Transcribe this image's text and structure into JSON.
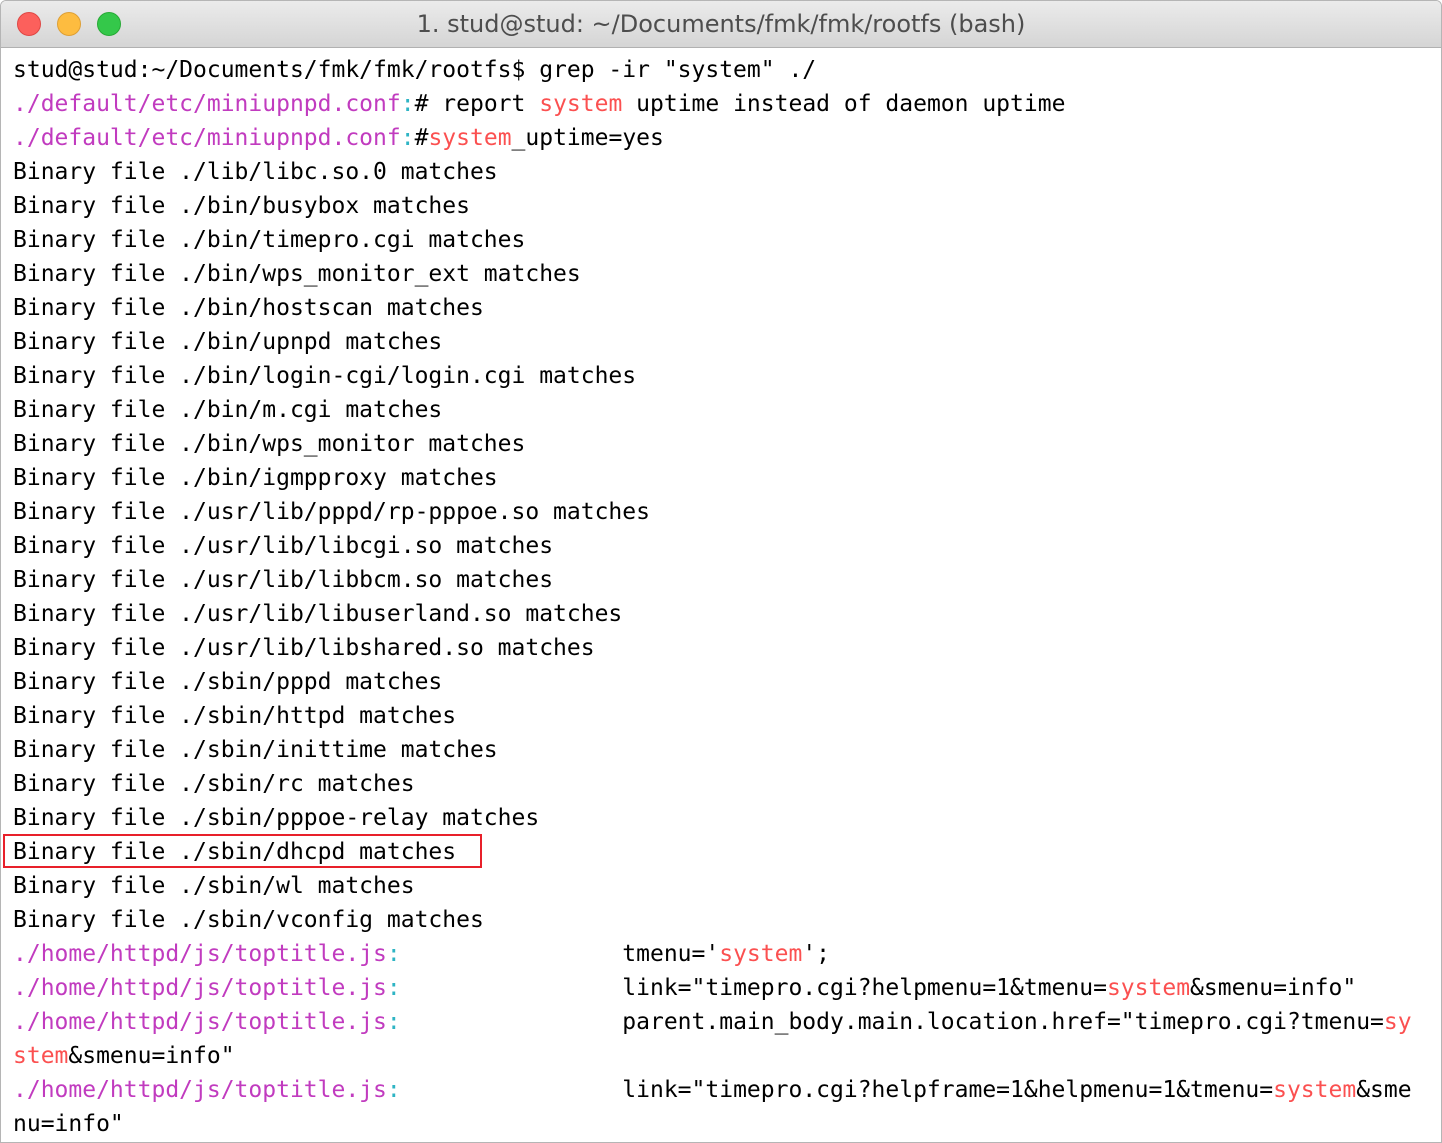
{
  "window": {
    "title": "1. stud@stud: ~/Documents/fmk/fmk/rootfs (bash)"
  },
  "terminal": {
    "command_line": "stud@stud:~/Documents/fmk/fmk/rootfs$ grep -ir \"system\" ./",
    "lines": [
      [
        {
          "t": "./default/etc/miniupnpd.conf",
          "c": "path"
        },
        {
          "t": ":",
          "c": "sep"
        },
        {
          "t": "# report "
        },
        {
          "t": "system",
          "c": "match"
        },
        {
          "t": " uptime instead of daemon uptime"
        }
      ],
      [
        {
          "t": "./default/etc/miniupnpd.conf",
          "c": "path"
        },
        {
          "t": ":",
          "c": "sep"
        },
        {
          "t": "#"
        },
        {
          "t": "system",
          "c": "match"
        },
        {
          "t": "_uptime=yes"
        }
      ],
      [
        {
          "t": "Binary file ./lib/libc.so.0 matches"
        }
      ],
      [
        {
          "t": "Binary file ./bin/busybox matches"
        }
      ],
      [
        {
          "t": "Binary file ./bin/timepro.cgi matches"
        }
      ],
      [
        {
          "t": "Binary file ./bin/wps_monitor_ext matches"
        }
      ],
      [
        {
          "t": "Binary file ./bin/hostscan matches"
        }
      ],
      [
        {
          "t": "Binary file ./bin/upnpd matches"
        }
      ],
      [
        {
          "t": "Binary file ./bin/login-cgi/login.cgi matches"
        }
      ],
      [
        {
          "t": "Binary file ./bin/m.cgi matches"
        }
      ],
      [
        {
          "t": "Binary file ./bin/wps_monitor matches"
        }
      ],
      [
        {
          "t": "Binary file ./bin/igmpproxy matches"
        }
      ],
      [
        {
          "t": "Binary file ./usr/lib/pppd/rp-pppoe.so matches"
        }
      ],
      [
        {
          "t": "Binary file ./usr/lib/libcgi.so matches"
        }
      ],
      [
        {
          "t": "Binary file ./usr/lib/libbcm.so matches"
        }
      ],
      [
        {
          "t": "Binary file ./usr/lib/libuserland.so matches"
        }
      ],
      [
        {
          "t": "Binary file ./usr/lib/libshared.so matches"
        }
      ],
      [
        {
          "t": "Binary file ./sbin/pppd matches"
        }
      ],
      [
        {
          "t": "Binary file ./sbin/httpd matches"
        }
      ],
      [
        {
          "t": "Binary file ./sbin/inittime matches"
        }
      ],
      [
        {
          "t": "Binary file ./sbin/rc matches"
        }
      ],
      [
        {
          "t": "Binary file ./sbin/pppoe-relay matches"
        }
      ],
      [
        {
          "t": "Binary file ./sbin/dhcpd matches"
        }
      ],
      [
        {
          "t": "Binary file ./sbin/wl matches"
        }
      ],
      [
        {
          "t": "Binary file ./sbin/vconfig matches"
        }
      ],
      [
        {
          "t": "./home/httpd/js/toptitle.js",
          "c": "path"
        },
        {
          "t": ":",
          "c": "sep"
        },
        {
          "t": "\t\t\ttmenu='"
        },
        {
          "t": "system",
          "c": "match"
        },
        {
          "t": "';"
        }
      ],
      [
        {
          "t": "./home/httpd/js/toptitle.js",
          "c": "path"
        },
        {
          "t": ":",
          "c": "sep"
        },
        {
          "t": "\t\t\tlink=\"timepro.cgi?helpmenu=1&tmenu="
        },
        {
          "t": "system",
          "c": "match"
        },
        {
          "t": "&smenu=info\""
        }
      ],
      [
        {
          "t": "./home/httpd/js/toptitle.js",
          "c": "path"
        },
        {
          "t": ":",
          "c": "sep"
        },
        {
          "t": "\t\t\tparent.main_body.main.location.href=\"timepro.cgi?tmenu="
        },
        {
          "t": "sy",
          "c": "match"
        }
      ],
      [
        {
          "t": "stem",
          "c": "match"
        },
        {
          "t": "&smenu=info\""
        }
      ],
      [
        {
          "t": "./home/httpd/js/toptitle.js",
          "c": "path"
        },
        {
          "t": ":",
          "c": "sep"
        },
        {
          "t": "\t\t\tlink=\"timepro.cgi?helpframe=1&helpmenu=1&tmenu="
        },
        {
          "t": "system",
          "c": "match"
        },
        {
          "t": "&sme"
        }
      ],
      [
        {
          "t": "nu=info\""
        }
      ]
    ]
  },
  "highlight": {
    "color": "#e8202a"
  },
  "colors": {
    "path": "#c13bbf",
    "separator": "#2eb4c4",
    "match": "#fb5050",
    "text": "#000000"
  },
  "icons": [
    "close-button",
    "minimize-button",
    "zoom-button"
  ]
}
